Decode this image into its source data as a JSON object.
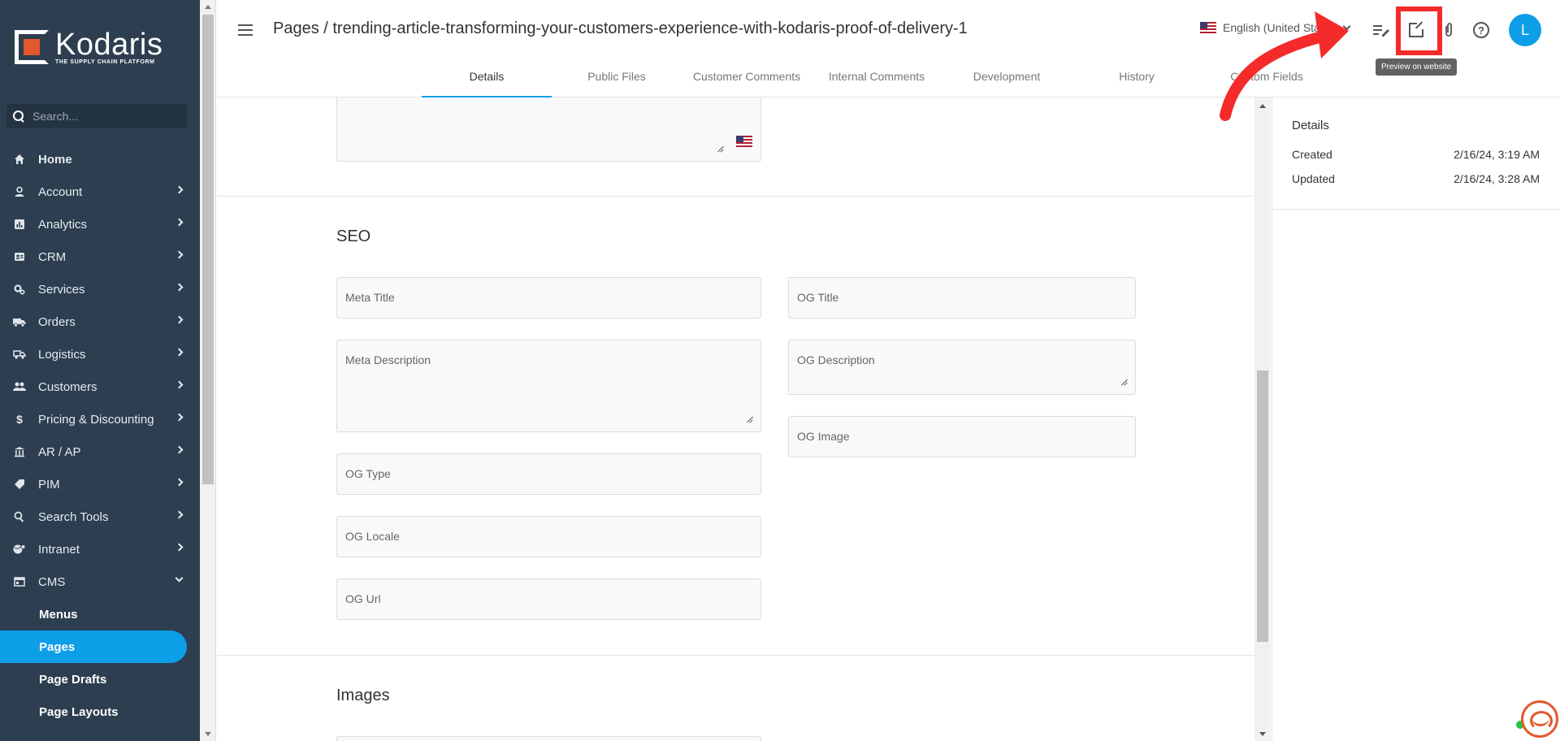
{
  "brand": {
    "name": "Kodaris",
    "tagline": "THE SUPPLY CHAIN PLATFORM"
  },
  "search": {
    "placeholder": "Search..."
  },
  "nav": [
    {
      "label": "Home",
      "icon": "home-icon"
    },
    {
      "label": "Account",
      "icon": "person-icon"
    },
    {
      "label": "Analytics",
      "icon": "analytics-icon"
    },
    {
      "label": "CRM",
      "icon": "contact-card-icon"
    },
    {
      "label": "Services",
      "icon": "gears-icon"
    },
    {
      "label": "Orders",
      "icon": "truck-icon"
    },
    {
      "label": "Logistics",
      "icon": "shipping-icon"
    },
    {
      "label": "Customers",
      "icon": "people-icon"
    },
    {
      "label": "Pricing & Discounting",
      "icon": "dollar-icon"
    },
    {
      "label": "AR / AP",
      "icon": "bank-icon"
    },
    {
      "label": "PIM",
      "icon": "tag-icon"
    },
    {
      "label": "Search Tools",
      "icon": "search-icon"
    },
    {
      "label": "Intranet",
      "icon": "globe-gear-icon"
    },
    {
      "label": "CMS",
      "icon": "window-icon"
    }
  ],
  "cms_sub": [
    "Menus",
    "Pages",
    "Page Drafts",
    "Page Layouts"
  ],
  "header": {
    "title": "Pages / trending-article-transforming-your-customers-experience-with-kodaris-proof-of-delivery-1",
    "language": "English (United States)",
    "tooltip": "Preview on website",
    "avatar": "L"
  },
  "tabs": [
    "Details",
    "Public Files",
    "Customer Comments",
    "Internal Comments",
    "Development",
    "History",
    "Custom Fields"
  ],
  "seo": {
    "title": "SEO",
    "meta_title": "Meta Title",
    "meta_description": "Meta Description",
    "og_type": "OG Type",
    "og_locale": "OG Locale",
    "og_url": "OG Url",
    "og_title": "OG Title",
    "og_description": "OG Description",
    "og_image": "OG Image"
  },
  "images": {
    "title": "Images"
  },
  "details_panel": {
    "title": "Details",
    "created_label": "Created",
    "created_value": "2/16/24, 3:19 AM",
    "updated_label": "Updated",
    "updated_value": "2/16/24, 3:28 AM"
  },
  "colors": {
    "sidebar": "#2c3e50",
    "accent": "#0d9ee8",
    "highlight": "#f52a2a"
  }
}
